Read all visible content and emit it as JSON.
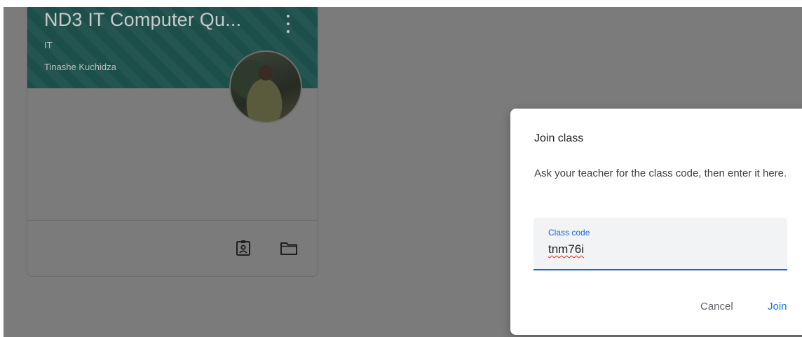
{
  "class_card": {
    "title": "ND3 IT Computer Qu...",
    "section": "IT",
    "teacher": "Tinashe Kuchidza",
    "icons": {
      "menu": "more-vert-icon",
      "assignments": "assignment-ind-icon",
      "folder": "folder-icon"
    }
  },
  "dialog": {
    "title": "Join class",
    "description": "Ask your teacher for the class code, then enter it here.",
    "field_label": "Class code",
    "field_value": "tnm76i",
    "cancel_label": "Cancel",
    "join_label": "Join"
  },
  "colors": {
    "accent": "#1a73e8",
    "overlay": "#7b7b7b",
    "dialog_background": "#ffffff"
  }
}
